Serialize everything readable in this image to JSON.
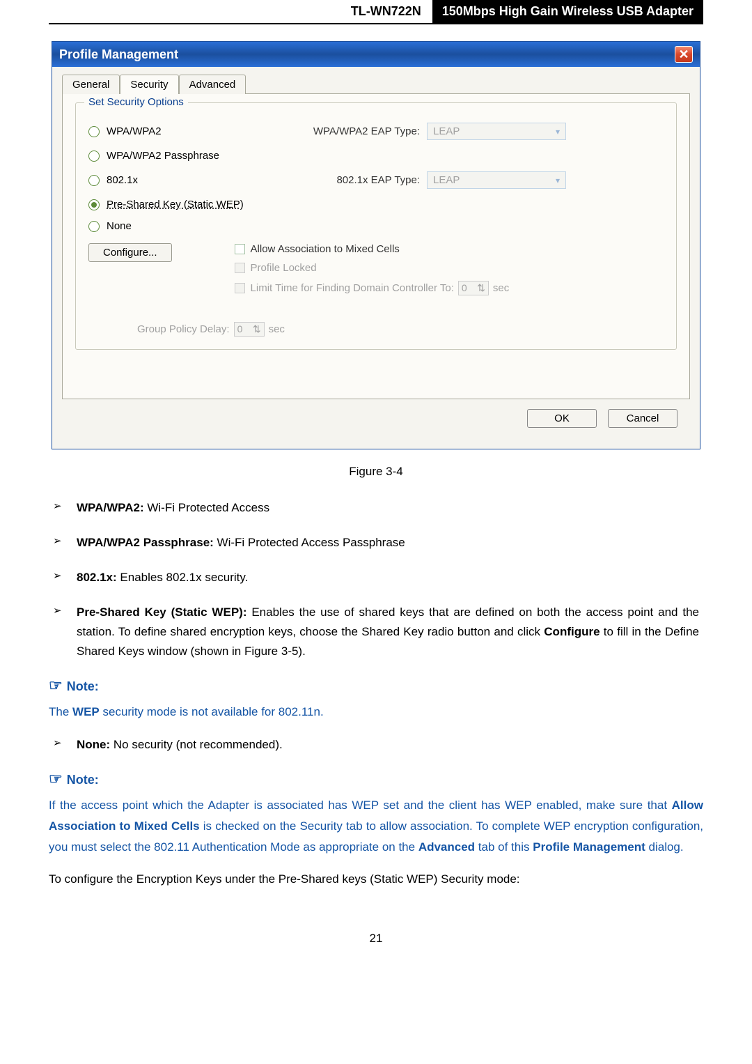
{
  "header": {
    "model": "TL-WN722N",
    "desc": "150Mbps High Gain Wireless USB Adapter"
  },
  "dialog": {
    "title": "Profile Management",
    "tabs": {
      "general": "General",
      "security": "Security",
      "advanced": "Advanced"
    },
    "fieldset_title": "Set Security Options",
    "options": {
      "wpa": "WPA/WPA2",
      "wpa_pass": "WPA/WPA2 Passphrase",
      "dot1x": "802.1x",
      "psk": "Pre-Shared Key (Static WEP)",
      "none": "None"
    },
    "labels": {
      "wpa_eap": "WPA/WPA2 EAP Type:",
      "dot1x_eap": "802.1x EAP Type:"
    },
    "combo": {
      "wpa_eap_value": "LEAP",
      "dot1x_eap_value": "LEAP"
    },
    "config_btn": "Configure...",
    "checks": {
      "mixed": "Allow Association to Mixed Cells",
      "locked": "Profile Locked",
      "limit_prefix": "Limit Time for Finding Domain Controller To:",
      "limit_value": "0",
      "sec": "sec"
    },
    "gpd": {
      "label": "Group Policy Delay:",
      "value": "0",
      "sec": "sec"
    },
    "buttons": {
      "ok": "OK",
      "cancel": "Cancel"
    }
  },
  "figure_caption": "Figure 3-4",
  "bullets": {
    "b1_label": "WPA/WPA2:",
    "b1_text": " Wi-Fi Protected Access",
    "b2_label": "WPA/WPA2 Passphrase:",
    "b2_text": " Wi-Fi Protected Access Passphrase",
    "b3_label": "802.1x:",
    "b3_text": " Enables 802.1x security.",
    "b4_label": "Pre-Shared Key (Static WEP):",
    "b4_text": " Enables the use of shared keys that are defined on both the access point and the station. To define shared encryption keys, choose the Shared Key radio button and click ",
    "b4_bold": "Configure",
    "b4_tail": " to fill in the Define Shared Keys window (shown in Figure 3-5).",
    "b5_label": "None:",
    "b5_text": " No security (not recommended)."
  },
  "note1": {
    "hdr": "Note:",
    "text_pre": "The ",
    "text_bold": "WEP",
    "text_post": " security mode is not available for 802.11n."
  },
  "note2": {
    "hdr": "Note:",
    "line1_pre": "If the access point which the Adapter is associated has WEP set and the client has WEP enabled, make sure that ",
    "line1_b1": "Allow Association to Mixed Cells",
    "line1_mid": " is checked on the Security tab to allow association. To complete WEP encryption configuration, you must select the 802.11 Authentication Mode as appropriate on the ",
    "line1_b2": "Advanced",
    "line1_mid2": " tab of this ",
    "line1_b3": "Profile Management",
    "line1_end": " dialog."
  },
  "final_para": "To configure the Encryption Keys under the Pre-Shared keys (Static WEP) Security mode:",
  "page_num": "21"
}
